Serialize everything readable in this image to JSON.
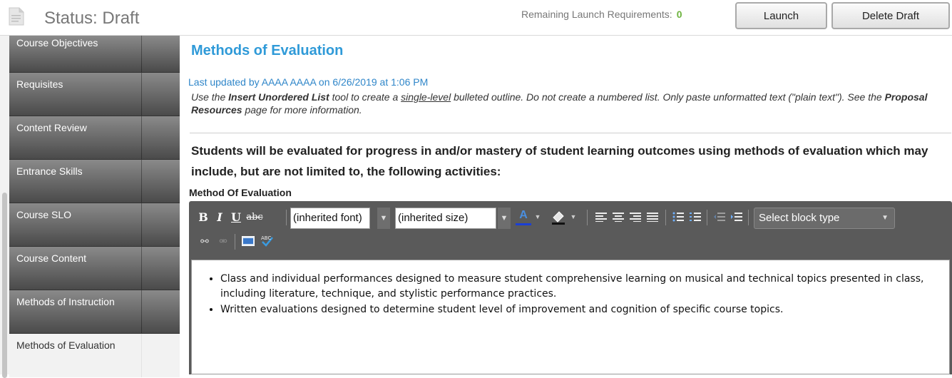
{
  "header": {
    "status_title": "Status: Draft",
    "requirements_label": "Remaining Launch Requirements:",
    "requirements_count": "0",
    "launch_button": "Launch",
    "delete_button": "Delete Draft"
  },
  "sidebar": {
    "items": [
      {
        "label": "Course Objectives",
        "active": false
      },
      {
        "label": "Requisites",
        "active": false
      },
      {
        "label": "Content Review",
        "active": false
      },
      {
        "label": "Entrance Skills",
        "active": false
      },
      {
        "label": "Course SLO",
        "active": false
      },
      {
        "label": "Course Content",
        "active": false
      },
      {
        "label": "Methods of Instruction",
        "active": false
      },
      {
        "label": "Methods of Evaluation",
        "active": true
      }
    ]
  },
  "main": {
    "section_title": "Methods of Evaluation",
    "last_updated": "Last updated by AAAA AAAA on 6/26/2019 at 1:06 PM",
    "instructions": {
      "p1": "Use the ",
      "b1": "Insert Unordered List",
      "p2": " tool to create a ",
      "u1": "single-level",
      "p3": " bulleted outline. Do not create a numbered list. Only paste unformatted text (\"plain text\"). See the ",
      "b2": "Proposal Resources",
      "p4": " page for more information."
    },
    "prompt": "Students will be evaluated for progress in and/or mastery of student learning outcomes using methods of evaluation which may include, but are not limited to, the following activities:",
    "field_label": "Method Of Evaluation"
  },
  "editor": {
    "font_family": "(inherited font)",
    "font_size": "(inherited size)",
    "block_type": "Select block type",
    "bold_icon": "B",
    "italic_icon": "I",
    "underline_icon": "U",
    "strike_icon": "abc",
    "spellcheck_icon": "ABC",
    "content": [
      "Class and individual performances designed to measure student comprehensive learning on musical and technical topics presented in class, including literature, technique, and stylistic performance practices.",
      "Written evaluations designed to determine student level of improvement and cognition of specific course topics."
    ]
  },
  "colors": {
    "title_blue": "#2f9ad8",
    "requirement_green": "#6db33f",
    "toolbar_bg": "#5a5a5a"
  }
}
